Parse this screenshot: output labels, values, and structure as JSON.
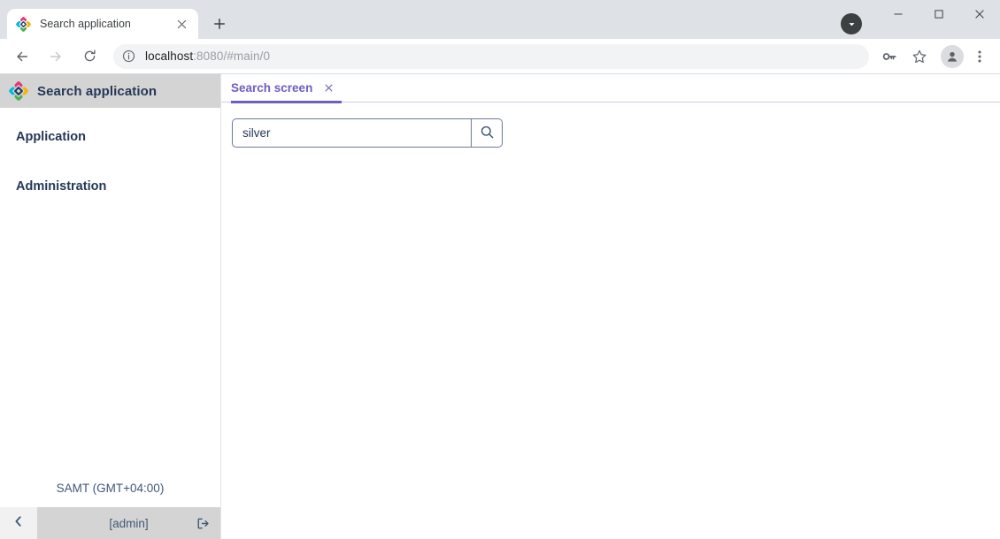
{
  "browser": {
    "tab": {
      "title": "Search application",
      "favicon_icon": "app-diamond-favicon",
      "close_icon": "close-icon"
    },
    "new_tab_icon": "plus-icon",
    "tab_list_icon": "chevron-down-icon",
    "window_controls": {
      "minimize_icon": "minimize-icon",
      "maximize_icon": "maximize-icon",
      "close_icon": "close-icon"
    },
    "toolbar": {
      "back_icon": "arrow-left-icon",
      "forward_icon": "arrow-right-icon",
      "reload_icon": "reload-icon",
      "site_info_icon": "info-circle-icon",
      "url_host": "localhost",
      "url_rest": ":8080/#main/0",
      "url_full": "localhost:8080/#main/0",
      "password_icon": "key-icon",
      "bookmark_icon": "star-icon",
      "profile_icon": "avatar-icon",
      "menu_icon": "three-dots-vertical-icon"
    }
  },
  "sidebar": {
    "logo_icon": "app-diamond-logo",
    "title": "Search application",
    "items": [
      {
        "label": "Application"
      },
      {
        "label": "Administration"
      }
    ],
    "timezone": "SAMT (GMT+04:00)",
    "collapse_icon": "chevron-left-icon",
    "user": "[admin]",
    "logout_icon": "logout-icon"
  },
  "main": {
    "tabs": [
      {
        "label": "Search screen",
        "close_icon": "close-icon",
        "active": true
      }
    ],
    "search": {
      "value": "silver",
      "placeholder": "",
      "button_icon": "search-icon"
    }
  },
  "colors": {
    "accent_purple": "#6b5ec4",
    "tab_strip_bg": "#dee1e6",
    "sidebar_header_bg": "#d4d4d4",
    "text_navy": "#253858",
    "border_blue_gray": "#6b7a99"
  }
}
